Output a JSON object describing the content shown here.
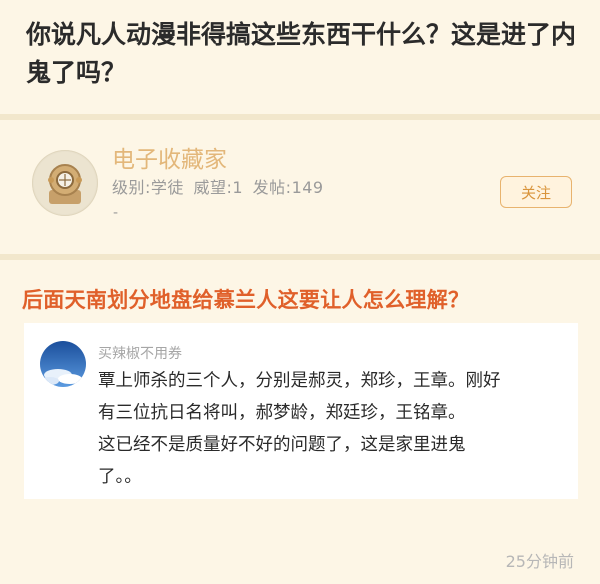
{
  "post": {
    "title": "你说凡人动漫非得搞这些东西干什么？这是进了内鬼了吗？"
  },
  "author": {
    "name": "电子收藏家",
    "level_label": "级别:学徒",
    "prestige_label": "威望:1",
    "posts_label": "发帖:149",
    "meta_tail": "-",
    "avatar_icon": "diving-helmet-icon"
  },
  "actions": {
    "follow_label": "关注"
  },
  "content": {
    "question": "后面天南划分地盘给慕兰人这要让人怎么理解？"
  },
  "comment": {
    "username": "买辣椒不用券",
    "avatar_icon": "blue-sky-avatar-icon",
    "lines": [
      "覃上师杀的三个人，分别是郝灵，郑珍，王章。刚好",
      "有三位抗日名将叫，郝梦龄，郑廷珍，王铭章。",
      "这已经不是质量好不好的问题了，这是家里进鬼",
      "了。。"
    ]
  },
  "footer": {
    "timestamp": "25分钟前"
  },
  "colors": {
    "page_bg": "#fdf6e6",
    "username": "#e3b77a",
    "question": "#e0602a",
    "follow_border": "#e8b36e"
  }
}
